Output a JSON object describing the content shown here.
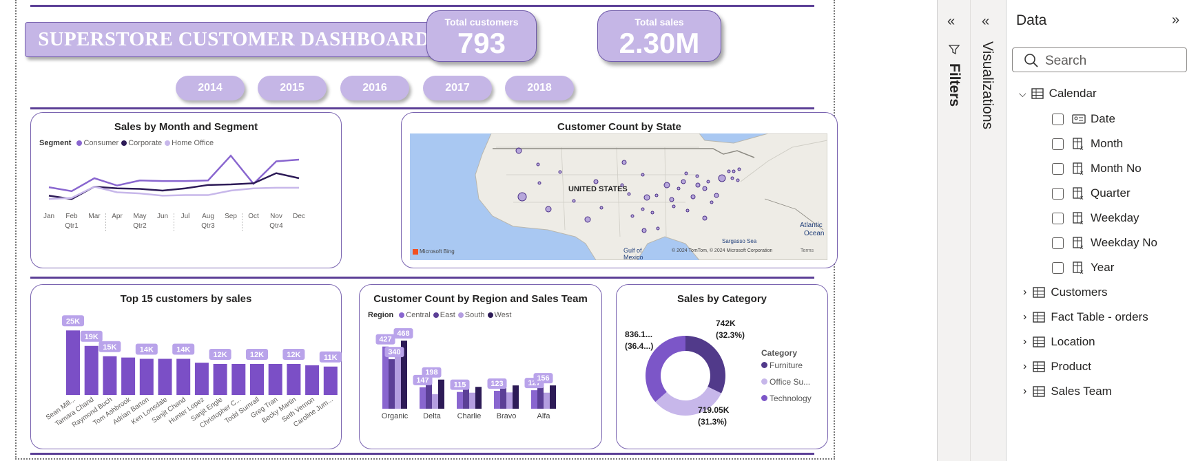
{
  "dashboard": {
    "title": "SUPERSTORE CUSTOMER DASHBOARD",
    "kpis": {
      "customers": {
        "label": "Total customers",
        "value": "793"
      },
      "sales": {
        "label": "Total sales",
        "value": "2.30M"
      }
    },
    "years": [
      "2014",
      "2015",
      "2016",
      "2017",
      "2018"
    ]
  },
  "colors": {
    "accent": "#5b3f96",
    "tile": "#c5b6e6",
    "consumer": "#8966cf",
    "corporate": "#2d1b57",
    "home_office": "#c7b7ea",
    "central": "#8966cf",
    "east": "#5b3f96",
    "south": "#b49ee0",
    "west": "#2d1b57",
    "furniture": "#513a8a",
    "office_supplies": "#c7b7ea",
    "technology": "#7c56c8",
    "bar": "#7b4fc6"
  },
  "charts": {
    "sales_month_segment": {
      "title": "Sales by Month and Segment",
      "legend_title": "Segment",
      "quarters": [
        "Qtr1",
        "Qtr2",
        "Qtr3",
        "Qtr4"
      ]
    },
    "customer_state": {
      "title": "Customer Count by State",
      "map_label": "UNITED STATES",
      "water_labels": {
        "gulf": "Gulf of",
        "mexico": "Mexico",
        "sargasso": "Sargasso Sea",
        "atlantic": "Atlantic",
        "ocean": "Ocean"
      },
      "attribution": "© 2024 TomTom, © 2024 Microsoft Corporation",
      "terms": "Terms",
      "brand": "Microsoft Bing"
    },
    "top15": {
      "title": "Top 15 customers by sales"
    },
    "region_team": {
      "title": "Customer Count by Region and Sales Team",
      "legend_title": "Region"
    },
    "category": {
      "title": "Sales by Category",
      "legend_title": "Category"
    }
  },
  "chart_data": [
    {
      "type": "line",
      "title": "Sales by Month and Segment",
      "x": [
        "Jan",
        "Feb",
        "Mar",
        "Apr",
        "May",
        "Jun",
        "Jul",
        "Aug",
        "Sep",
        "Oct",
        "Nov",
        "Dec"
      ],
      "series": [
        {
          "name": "Consumer",
          "values": [
            39,
            32,
            55,
            42,
            51,
            50,
            50,
            51,
            95,
            45,
            85,
            88
          ]
        },
        {
          "name": "Corporate",
          "values": [
            24,
            18,
            40,
            37,
            36,
            33,
            37,
            43,
            44,
            46,
            64,
            55
          ]
        },
        {
          "name": "Home Office",
          "values": [
            18,
            20,
            40,
            30,
            28,
            24,
            25,
            25,
            33,
            37,
            38,
            38
          ]
        }
      ],
      "ylim": [
        0,
        110
      ]
    },
    {
      "type": "bar",
      "title": "Top 15 customers by sales",
      "categories": [
        "Sean Mill...",
        "Tamara Chand",
        "Raymond Buch",
        "Tom Ashbrook",
        "Adrian Barton",
        "Ken Lonsdale",
        "Sanjit Chand",
        "Hunter Lopez",
        "Sanjit Engle",
        "Christopher C...",
        "Todd Sumrall",
        "Greg Tran",
        "Becky Martin",
        "Seth Vernon",
        "Caroline Jum..."
      ],
      "values": [
        25,
        19,
        15,
        14.5,
        14,
        14,
        14,
        12.5,
        12,
        12,
        12,
        12,
        12,
        11.5,
        11
      ],
      "data_labels": [
        "25K",
        "19K",
        "15K",
        "",
        "14K",
        "",
        "14K",
        "",
        "12K",
        "",
        "12K",
        "",
        "12K",
        "",
        "11K"
      ],
      "ylim": [
        0,
        28
      ]
    },
    {
      "type": "bar",
      "title": "Customer Count by Region and Sales Team",
      "categories": [
        "Organic",
        "Delta",
        "Charlie",
        "Bravo",
        "Alfa"
      ],
      "series": [
        {
          "name": "Central",
          "values": [
            427,
            147,
            115,
            123,
            127
          ]
        },
        {
          "name": "East",
          "values": [
            340,
            198,
            140,
            190,
            156
          ]
        },
        {
          "name": "South",
          "values": [
            370,
            100,
            110,
            112,
            110
          ]
        },
        {
          "name": "West",
          "values": [
            468,
            200,
            150,
            160,
            160
          ]
        }
      ],
      "data_labels": {
        "Organic": [
          "427",
          "340",
          "468"
        ],
        "Delta": [
          "147",
          "198"
        ],
        "Charlie": [
          "115"
        ],
        "Bravo": [
          "123"
        ],
        "Alfa": [
          "127",
          "156"
        ]
      },
      "ylim": [
        0,
        520
      ]
    },
    {
      "type": "pie",
      "title": "Sales by Category",
      "labels": [
        "Furniture",
        "Office Su...",
        "Technology"
      ],
      "values": [
        742000,
        719050,
        836100
      ],
      "data_labels": [
        [
          "742K",
          "(32.3%)"
        ],
        [
          "719.05K",
          "(31.3%)"
        ],
        [
          "836.1...",
          "(36.4...)"
        ]
      ]
    }
  ],
  "panes": {
    "filters_label": "Filters",
    "visualizations_label": "Visualizations",
    "data_title": "Data",
    "search_placeholder": "Search",
    "tree": {
      "calendar": "Calendar",
      "fields": [
        "Date",
        "Month",
        "Month No",
        "Quarter",
        "Weekday",
        "Weekday No",
        "Year"
      ],
      "tables": [
        "Customers",
        "Fact Table - orders",
        "Location",
        "Product",
        "Sales Team"
      ]
    }
  }
}
